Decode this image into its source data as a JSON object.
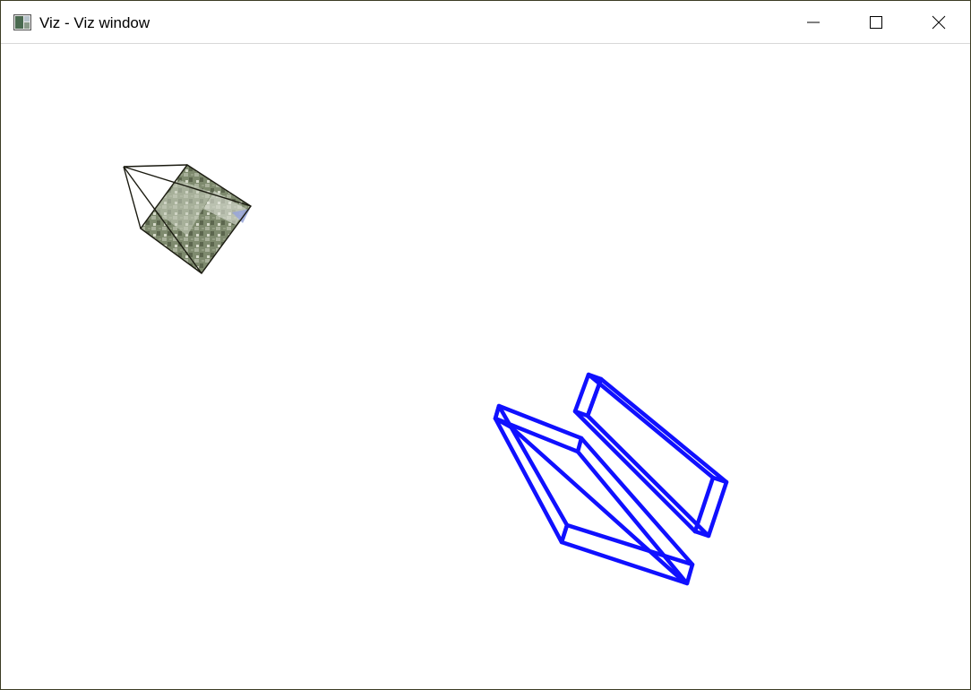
{
  "window": {
    "title": "Viz - Viz window",
    "app_icon": "viz-app-icon",
    "controls": {
      "minimize_icon": "minimize-icon",
      "maximize_icon": "maximize-icon",
      "close_icon": "close-icon"
    }
  },
  "scene": {
    "background_color": "#ffffff",
    "camera_frustum": {
      "icon": "camera-frustum",
      "line_color": "#1a1a10"
    },
    "boxes": {
      "icon": "wireframe-box",
      "color": "#1010ff",
      "count": 2
    }
  }
}
